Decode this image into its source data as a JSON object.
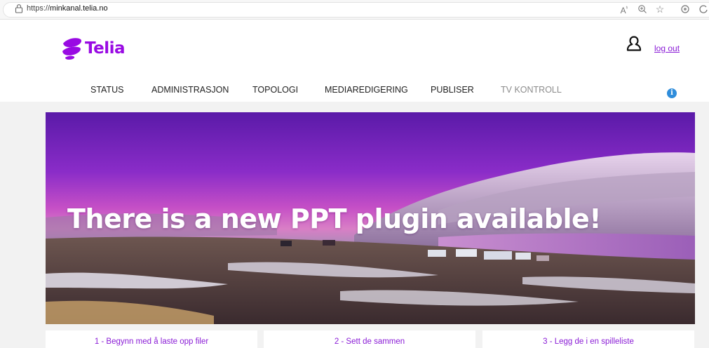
{
  "browser": {
    "url_prefix": "https://",
    "url_host": "minkanal.telia.no",
    "icons": [
      "lock-icon",
      "read-aloud-icon",
      "zoom-icon",
      "favorite-star-icon",
      "settings-icon",
      "extensions-icon"
    ]
  },
  "brand": {
    "name": "Telia",
    "color": "#990ae3"
  },
  "header": {
    "logout_label": "log out"
  },
  "nav": {
    "items": [
      {
        "label": "STATUS"
      },
      {
        "label": "ADMINISTRASJON"
      },
      {
        "label": "TOPOLOGI"
      },
      {
        "label": "MEDIAREDIGERING"
      },
      {
        "label": "PUBLISER"
      },
      {
        "label": "TV KONTROLL",
        "disabled": true
      }
    ],
    "info_label": "i"
  },
  "banner": {
    "headline": "There is a new PPT plugin available!"
  },
  "steps": [
    {
      "label": "1 - Begynn med å laste opp filer"
    },
    {
      "label": "2 - Sett de sammen"
    },
    {
      "label": "3 - Legg de i en spilleliste"
    }
  ]
}
